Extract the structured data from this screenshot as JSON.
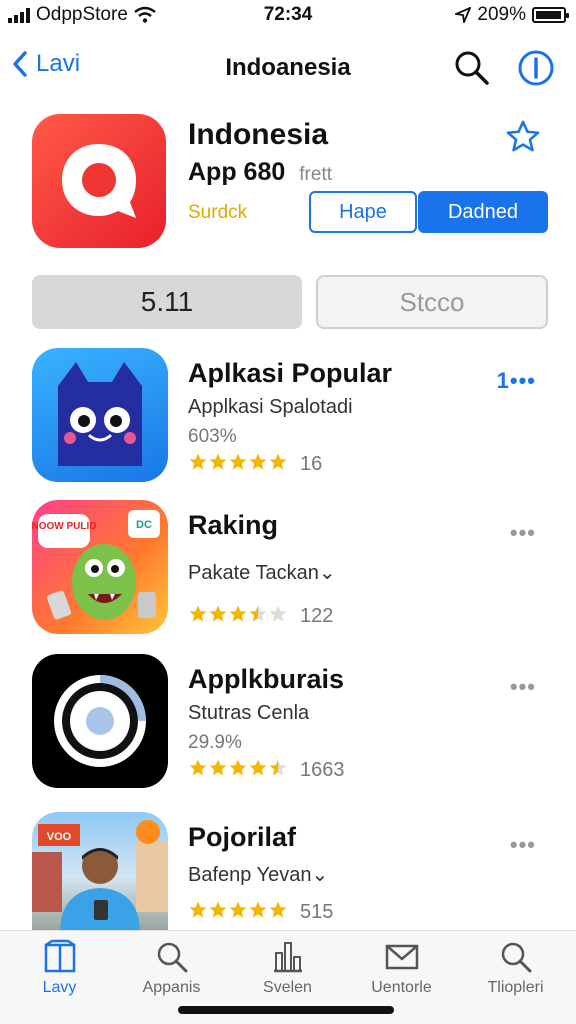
{
  "status_bar": {
    "carrier": "OdppStore",
    "time": "72:34",
    "battery": "209%"
  },
  "nav": {
    "back_label": "Lavi",
    "title": "Indoanesia"
  },
  "hero": {
    "title": "Indonesia",
    "subtitle": "App 680",
    "subtitle_note": "frett",
    "tag": "Surdck",
    "button_outline": "Hape",
    "button_solid": "Dadned"
  },
  "segments": {
    "left": "5.11",
    "right": "Stcco"
  },
  "apps": [
    {
      "title": "Aplkasi Popular",
      "subtitle": "Applkasi Spalotadi",
      "meta": "603%",
      "rating": 5,
      "count": "16",
      "more": "1•••"
    },
    {
      "title": "Raking",
      "subtitle": "Pakate Tackan⌄",
      "meta": "",
      "rating": 3.5,
      "count": "122",
      "more": "•••"
    },
    {
      "title": "Applkburais",
      "subtitle": "Stutras Cenla",
      "meta": "29.9%",
      "rating": 4.5,
      "count": "1663",
      "more": "•••"
    },
    {
      "title": "Pojorilaf",
      "subtitle": "Bafenp Yevan⌄",
      "meta": "",
      "rating": 5,
      "count": "515",
      "more": "•••"
    }
  ],
  "icon_labels": {
    "app2_badge_left": "NOOW PULID",
    "app2_badge_right": "DC",
    "app4_badge": "VOO"
  },
  "tabs": [
    {
      "label": "Lavy",
      "icon": "book-icon",
      "active": true
    },
    {
      "label": "Appanis",
      "icon": "search-icon",
      "active": false
    },
    {
      "label": "Svelen",
      "icon": "chart-icon",
      "active": false
    },
    {
      "label": "Uentorle",
      "icon": "mail-icon",
      "active": false
    },
    {
      "label": "Tliopleri",
      "icon": "search-icon",
      "active": false
    }
  ],
  "colors": {
    "accent": "#1a73e8",
    "star": "#f5b800",
    "hero_icon": "#ef3a35"
  }
}
